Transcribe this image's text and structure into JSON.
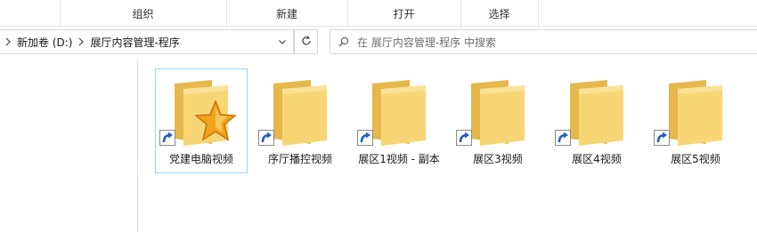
{
  "ribbon": {
    "groups": [
      "组织",
      "新建",
      "打开",
      "选择"
    ]
  },
  "address": {
    "crumbs": [
      "新加卷 (D:)",
      "展厅内容管理-程序"
    ]
  },
  "search": {
    "placeholder": "在 展厅内容管理-程序 中搜索"
  },
  "icons": {
    "chevron": "chevron-right-icon",
    "dropdown": "chevron-down-icon",
    "refresh": "refresh-icon",
    "search": "search-icon",
    "shortcut": "shortcut-arrow-icon",
    "folder": "folder-icon",
    "star": "star-icon"
  },
  "items": [
    {
      "label": "党建电脑视频",
      "selected": true,
      "star": true
    },
    {
      "label": "序厅播控视频",
      "selected": false,
      "star": false
    },
    {
      "label": "展区1视频 - 副本",
      "selected": false,
      "star": false
    },
    {
      "label": "展区3视频",
      "selected": false,
      "star": false
    },
    {
      "label": "展区4视频",
      "selected": false,
      "star": false
    },
    {
      "label": "展区5视频",
      "selected": false,
      "star": false
    }
  ],
  "colors": {
    "folder_back": "#e6b74a",
    "folder_front": "#f8d675",
    "selection_border": "#99d1ff",
    "shortcut_blue": "#1f5fbf"
  }
}
